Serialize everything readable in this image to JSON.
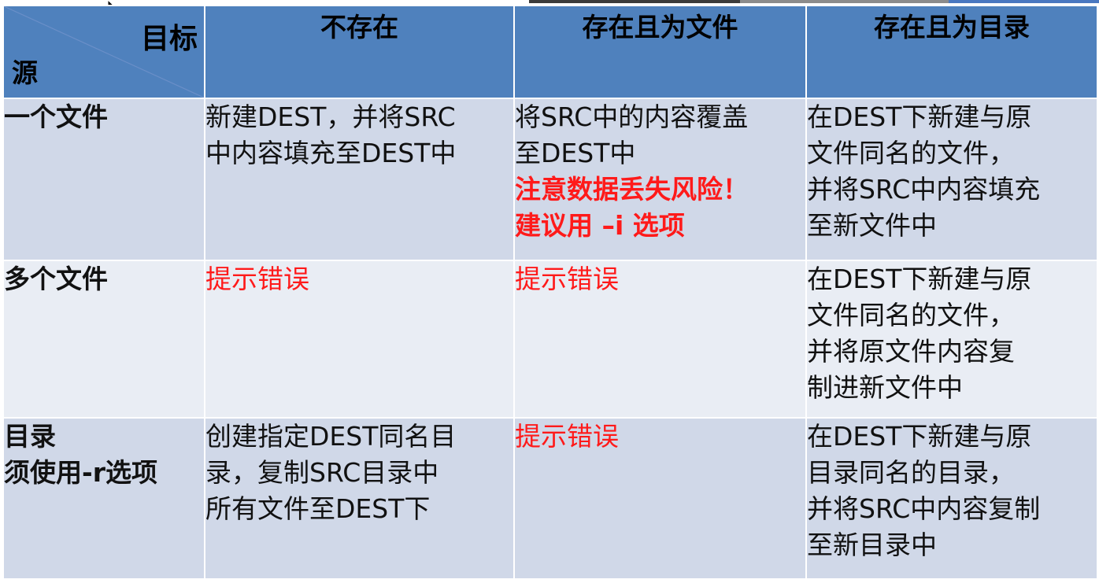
{
  "header": {
    "corner_target": "目标",
    "corner_source": "源",
    "col_not_exist": "不存在",
    "col_exists_file": "存在且为文件",
    "col_exists_dir": "存在且为目录"
  },
  "rows": [
    {
      "label_lines": [
        "一个文件"
      ],
      "not_exist": [
        "新建DEST，并将SRC",
        "中内容填充至DEST中"
      ],
      "exists_file": [
        "将SRC中的内容覆盖",
        "至DEST中"
      ],
      "exists_file_warning": [
        "注意数据丢失风险！",
        "建议用 –i  选项"
      ],
      "exists_dir": [
        "在DEST下新建与原",
        "文件同名的文件，",
        "并将SRC中内容填充",
        "至新文件中"
      ]
    },
    {
      "label_lines": [
        "多个文件"
      ],
      "not_exist": [
        "提示错误"
      ],
      "exists_file": [
        "提示错误"
      ],
      "exists_dir": [
        "在DEST下新建与原",
        "文件同名的文件，",
        "并将原文件内容复",
        "制进新文件中"
      ]
    },
    {
      "label_lines": [
        "目录",
        "须使用-r选项"
      ],
      "not_exist": [
        "创建指定DEST同名目",
        "录，复制SRC目录中",
        "所有文件至DEST下"
      ],
      "exists_file": [
        "提示错误"
      ],
      "exists_dir": [
        "在DEST下新建与原",
        "目录同名的目录，",
        "并将SRC中内容复制",
        "至新目录中"
      ]
    }
  ],
  "colors": {
    "header_bg": "#4f81bd",
    "row_dark": "#d0d8e8",
    "row_light": "#e9edf4",
    "error_red": "#ff1a1a"
  }
}
